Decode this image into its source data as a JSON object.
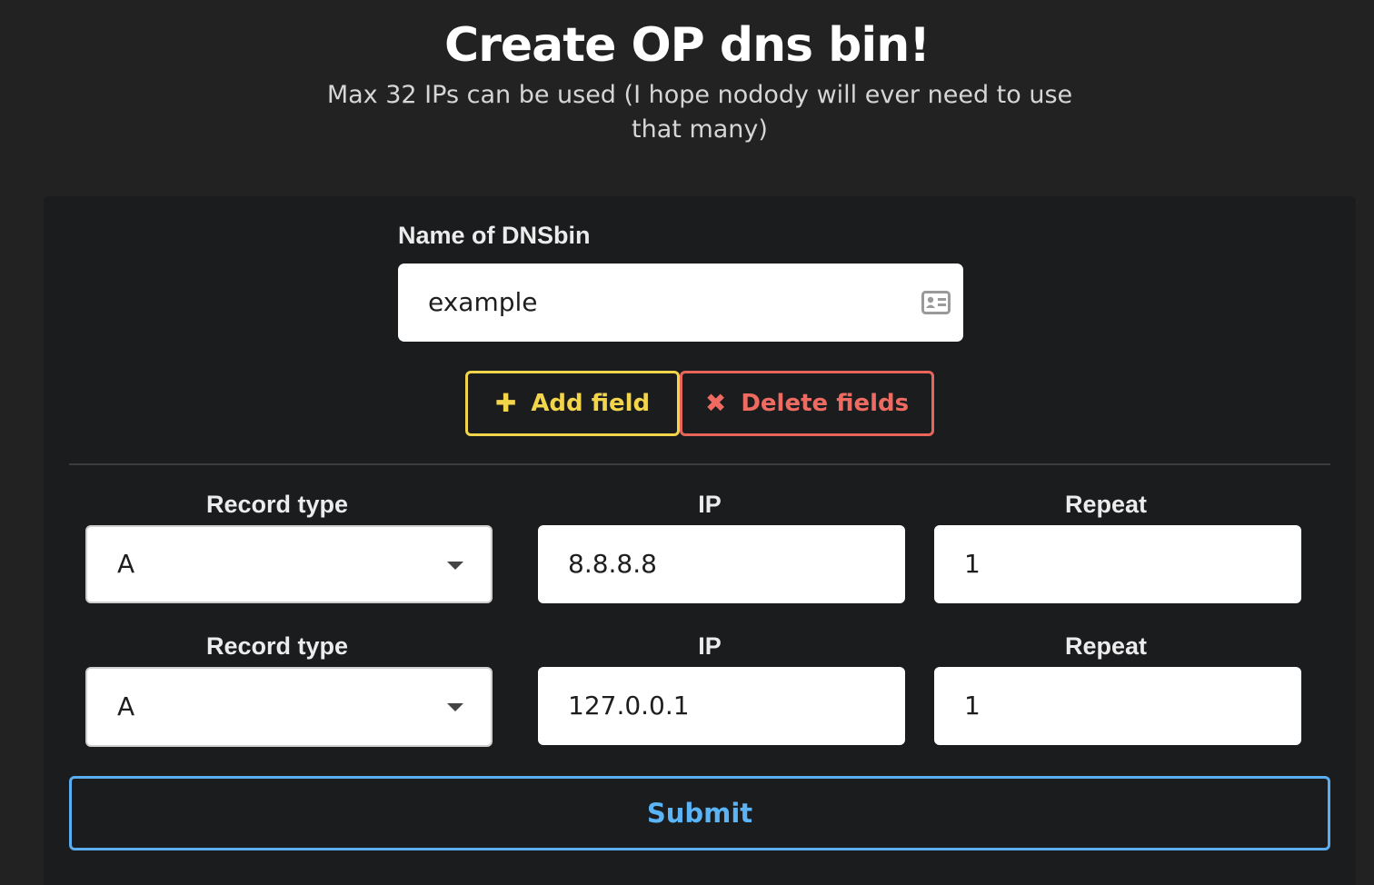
{
  "header": {
    "title": "Create OP dns bin!",
    "subtitle": "Max 32 IPs can be used (I hope nodody will ever need to use that many)"
  },
  "form": {
    "name_label": "Name of DNSbin",
    "name_value": "example",
    "add_label": "Add field",
    "delete_label": "Delete fields",
    "submit_label": "Submit",
    "records": [
      {
        "type_label": "Record type",
        "type_value": "A",
        "ip_label": "IP",
        "ip_value": "8.8.8.8",
        "repeat_label": "Repeat",
        "repeat_value": "1"
      },
      {
        "type_label": "Record type",
        "type_value": "A",
        "ip_label": "IP",
        "ip_value": "127.0.0.1",
        "repeat_label": "Repeat",
        "repeat_value": "1"
      }
    ]
  },
  "icons": {
    "name_input": "id-card-icon",
    "add": "plus-icon",
    "delete": "x-icon",
    "select": "caret-down-icon"
  },
  "colors": {
    "background": "#222223",
    "panel": "#1b1c1e",
    "add_accent": "#f2d54a",
    "delete_accent": "#e8655c",
    "submit_accent": "#5aaef0"
  }
}
